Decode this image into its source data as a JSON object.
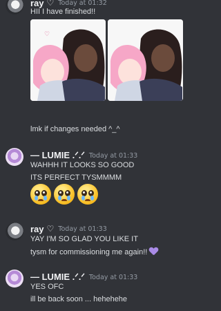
{
  "messages": [
    {
      "author": "ray",
      "timestamp": "Today at 01:32",
      "lines": [
        "HII I have finished!!",
        "lmk if changes needed ^_^"
      ],
      "attachments": [
        "artwork image",
        "artwork image"
      ]
    },
    {
      "author": "— LUMIE .ᐟ.ᐟ",
      "timestamp": "Today at 01:33",
      "lines": [
        "WAHHH IT LOOKS SO GOOD",
        "ITS PERFECT TYSMMMM"
      ],
      "emojis": [
        "pleading-face",
        "pleading-face",
        "pleading-face"
      ]
    },
    {
      "author": "ray",
      "timestamp": "Today at 01:33",
      "lines": [
        "YAY I'M SO GLAD YOU LIKE IT",
        "tysm for commissioning me again!!"
      ],
      "trailing_emoji": "purple-heart"
    },
    {
      "author": "— LUMIE .ᐟ.ᐟ",
      "timestamp": "Today at 01:33",
      "lines": [
        "YES OFC",
        "ill be back soon ... hehehehe"
      ]
    }
  ],
  "colors": {
    "background": "#313338",
    "text": "#dbdee1",
    "name": "#f2f3f5",
    "timestamp": "#949ba4",
    "purple_heart": "#a98be6"
  }
}
